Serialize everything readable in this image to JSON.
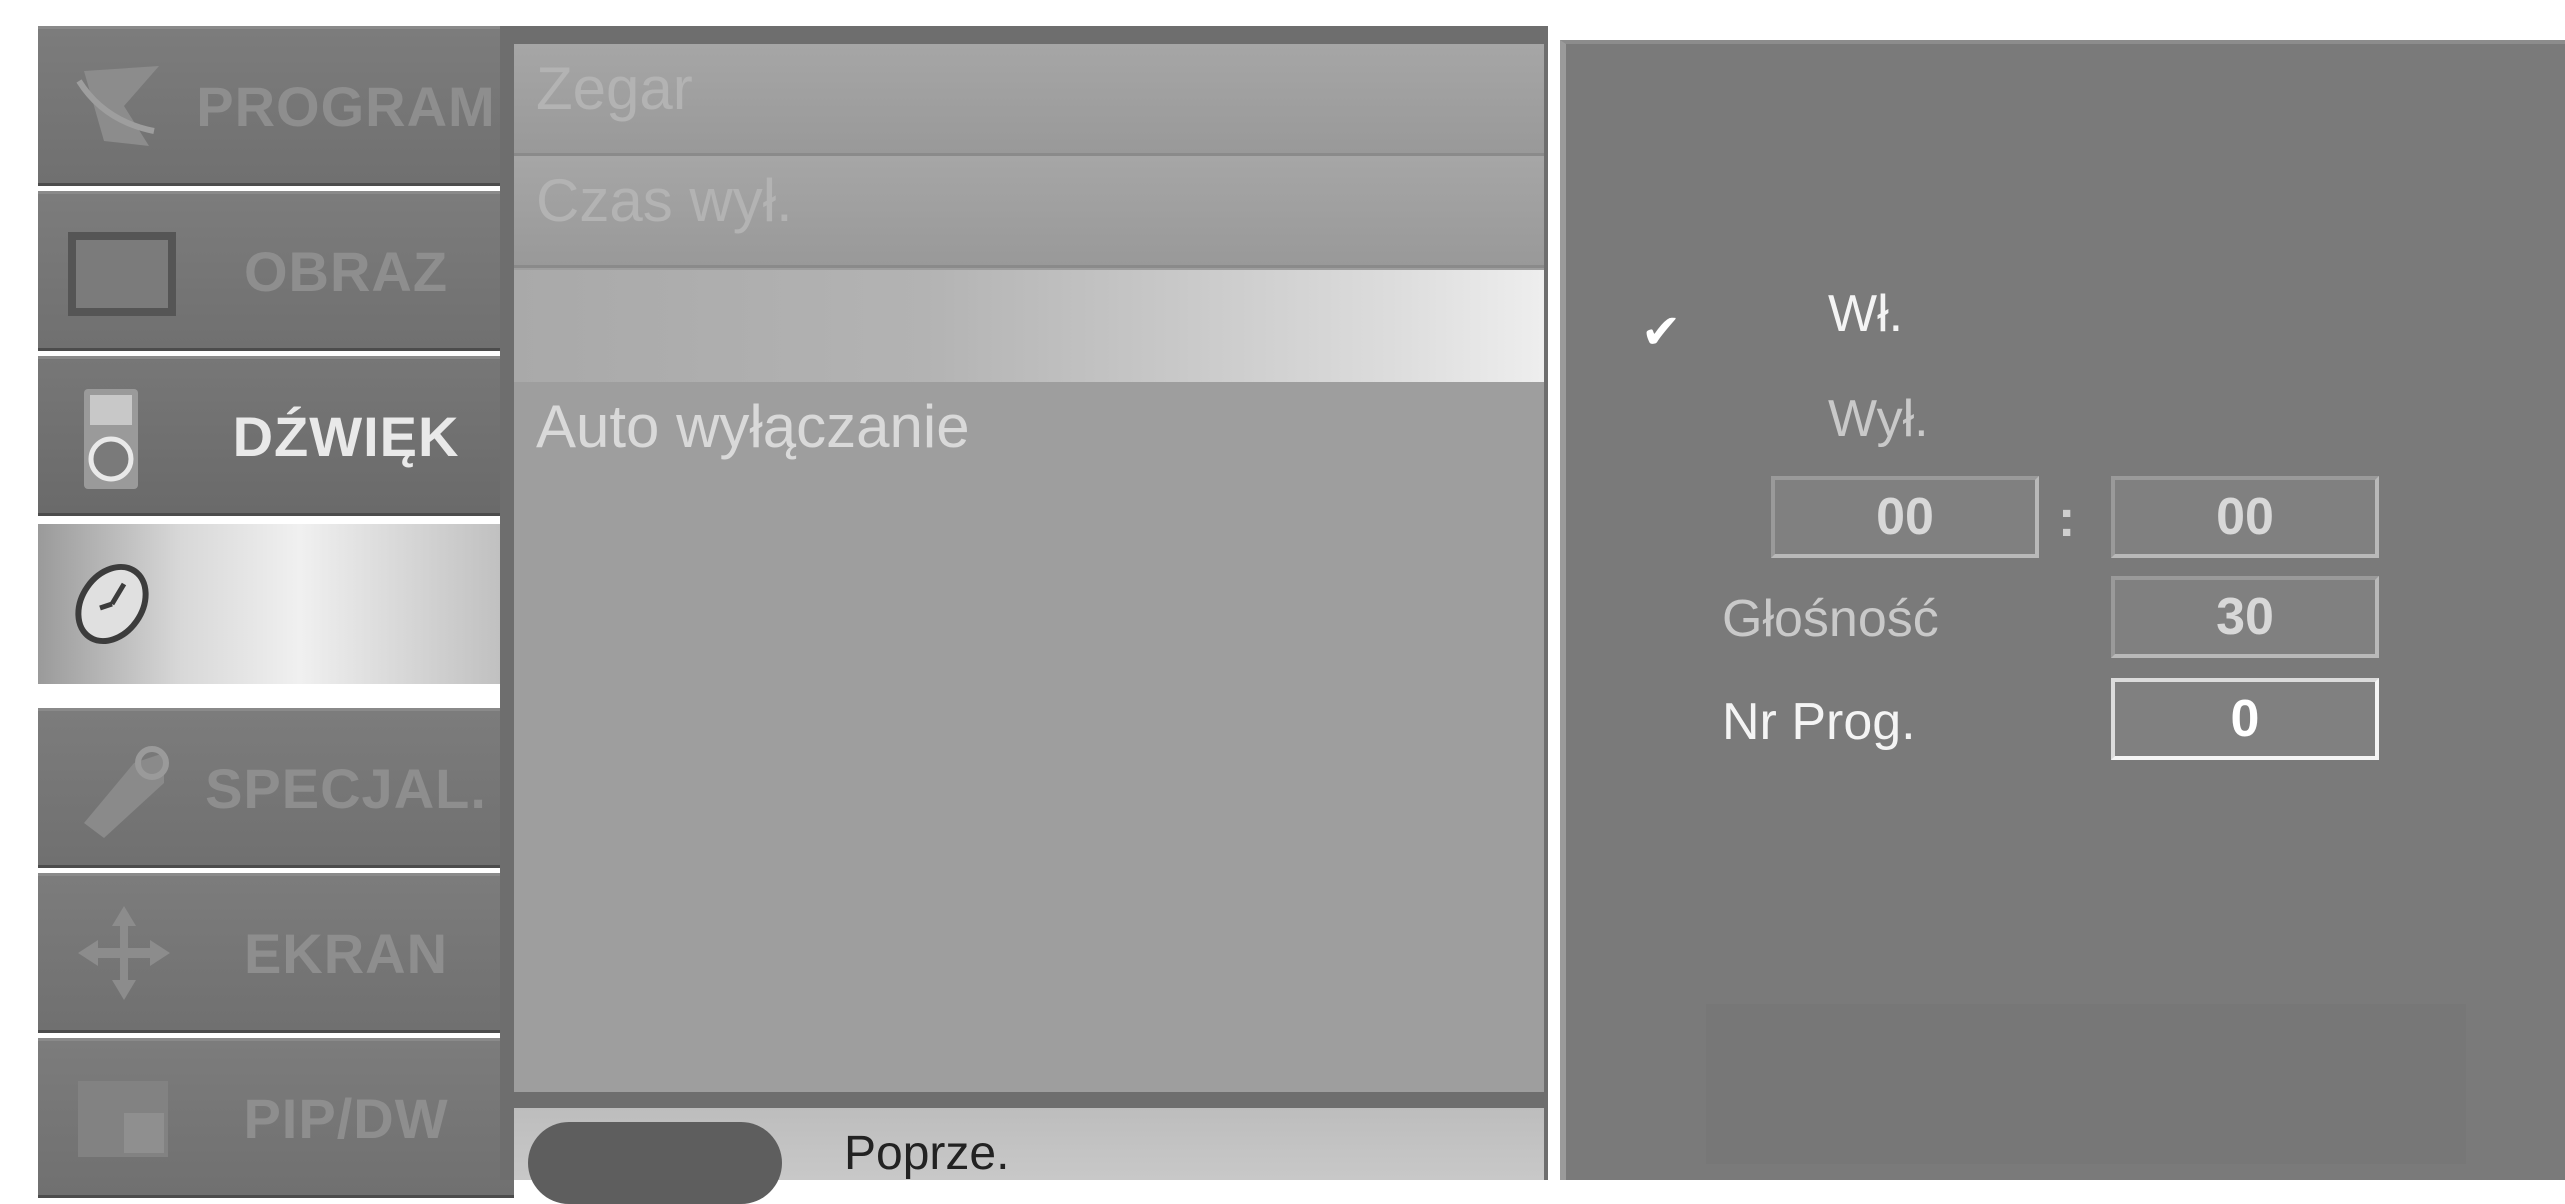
{
  "sidebar": {
    "items": [
      {
        "label": "PROGRAM",
        "icon": "satellite-dish-icon",
        "state": "dim"
      },
      {
        "label": "OBRAZ",
        "icon": "picture-screen-icon",
        "state": "dim"
      },
      {
        "label": "DŹWIĘK",
        "icon": "speaker-icon",
        "state": "bright"
      },
      {
        "label": "",
        "icon": "clock-icon",
        "state": "selected"
      },
      {
        "label": "SPECJAL.",
        "icon": "special-tag-icon",
        "state": "dim"
      },
      {
        "label": "EKRAN",
        "icon": "move-arrows-icon",
        "state": "dim"
      },
      {
        "label": "PIP/DW",
        "icon": "pip-icon",
        "state": "dim"
      }
    ]
  },
  "menu": {
    "items": [
      {
        "label": "Zegar",
        "state": "dim"
      },
      {
        "label": "Czas wył.",
        "state": "dim"
      },
      {
        "label": "",
        "state": "highlighted"
      },
      {
        "label": "Auto wyłączanie",
        "state": "active"
      }
    ],
    "footer_hint": "Poprze."
  },
  "values": {
    "on_label": "Wł.",
    "off_label": "Wył.",
    "checkmark": "✔",
    "hour": "00",
    "separator": ":",
    "minute": "00",
    "volume_label": "Głośność",
    "volume_value": "30",
    "program_label": "Nr Prog.",
    "program_value": "0"
  }
}
